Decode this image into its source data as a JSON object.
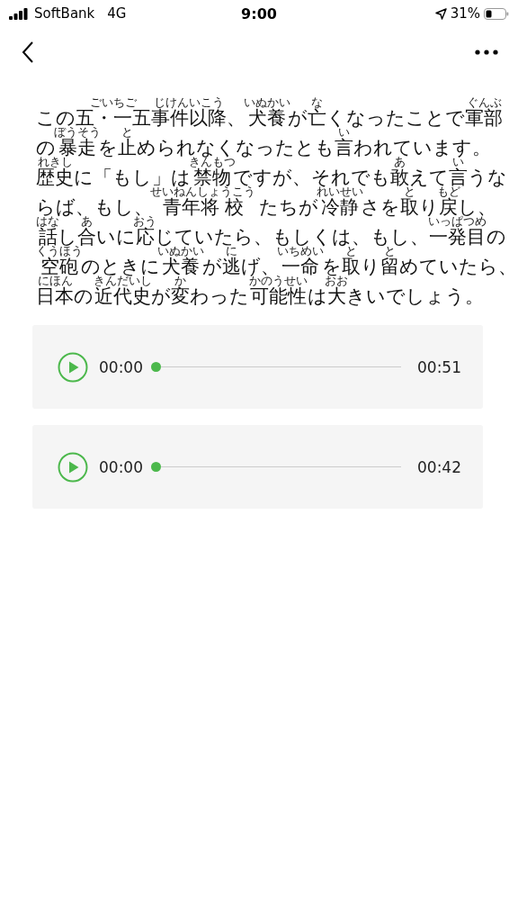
{
  "status_bar": {
    "carrier": "SoftBank",
    "network": "4G",
    "time": "9:00",
    "battery": "31%"
  },
  "lines": [
    [
      "この",
      {
        "reading": "ごいちご",
        "base": "五・一五"
      },
      {
        "reading": "じけんいこう",
        "base": "事件以降"
      },
      "、",
      {
        "reading": "いぬかい",
        "base": "犬養"
      },
      "が",
      {
        "reading": "な",
        "base": "亡"
      },
      "くなったことで",
      {
        "reading": "ぐんぶ",
        "base": "軍部"
      }
    ],
    [
      "の",
      {
        "reading": "ぼうそう",
        "base": "暴走"
      },
      "を",
      {
        "reading": "と",
        "base": "止"
      },
      "められなくなったとも",
      {
        "reading": "い",
        "base": "言"
      },
      "われています。"
    ],
    [
      {
        "reading": "れきし",
        "base": "歴史"
      },
      "に「もし」は",
      {
        "reading": "きんもつ",
        "base": "禁物"
      },
      "ですが、それでも",
      {
        "reading": "あ",
        "base": "敢"
      },
      "えて",
      {
        "reading": "い",
        "base": "言"
      },
      "うな"
    ],
    [
      "らば、もし、",
      {
        "reading": "せいねんしょうこう",
        "base": "青年将 校"
      },
      " たちが",
      {
        "reading": "れいせい",
        "base": "冷静"
      },
      "さを",
      {
        "reading": "と",
        "base": "取"
      },
      "り",
      {
        "reading": "もど",
        "base": "戻"
      },
      "し、"
    ],
    [
      {
        "reading": "はな",
        "base": "話"
      },
      "し",
      {
        "reading": "あ",
        "base": "合"
      },
      "いに",
      {
        "reading": "おう",
        "base": "応"
      },
      "じていたら、もしくは、もし、",
      {
        "reading": "いっぱつめ",
        "base": "一発目"
      },
      "の"
    ],
    [
      {
        "reading": "くうほう",
        "base": "空砲"
      },
      "のときに",
      {
        "reading": "いぬかい",
        "base": "犬養"
      },
      "が",
      {
        "reading": "に",
        "base": "逃"
      },
      "げ、",
      {
        "reading": "いちめい",
        "base": "一命"
      },
      "を",
      {
        "reading": "と",
        "base": "取"
      },
      "り",
      {
        "reading": "と",
        "base": "留"
      },
      "めていたら、"
    ],
    [
      {
        "reading": "にほん",
        "base": "日本"
      },
      "の",
      {
        "reading": "きんだいし",
        "base": "近代史"
      },
      "が",
      {
        "reading": "か",
        "base": "変"
      },
      "わった",
      {
        "reading": "かのうせい",
        "base": "可能性"
      },
      "は",
      {
        "reading": "おお",
        "base": "大"
      },
      "きいでしょう。"
    ]
  ],
  "players": [
    {
      "current": "00:00",
      "duration": "00:51",
      "level": 0
    },
    {
      "current": "00:00",
      "duration": "00:42",
      "level": 0
    }
  ]
}
